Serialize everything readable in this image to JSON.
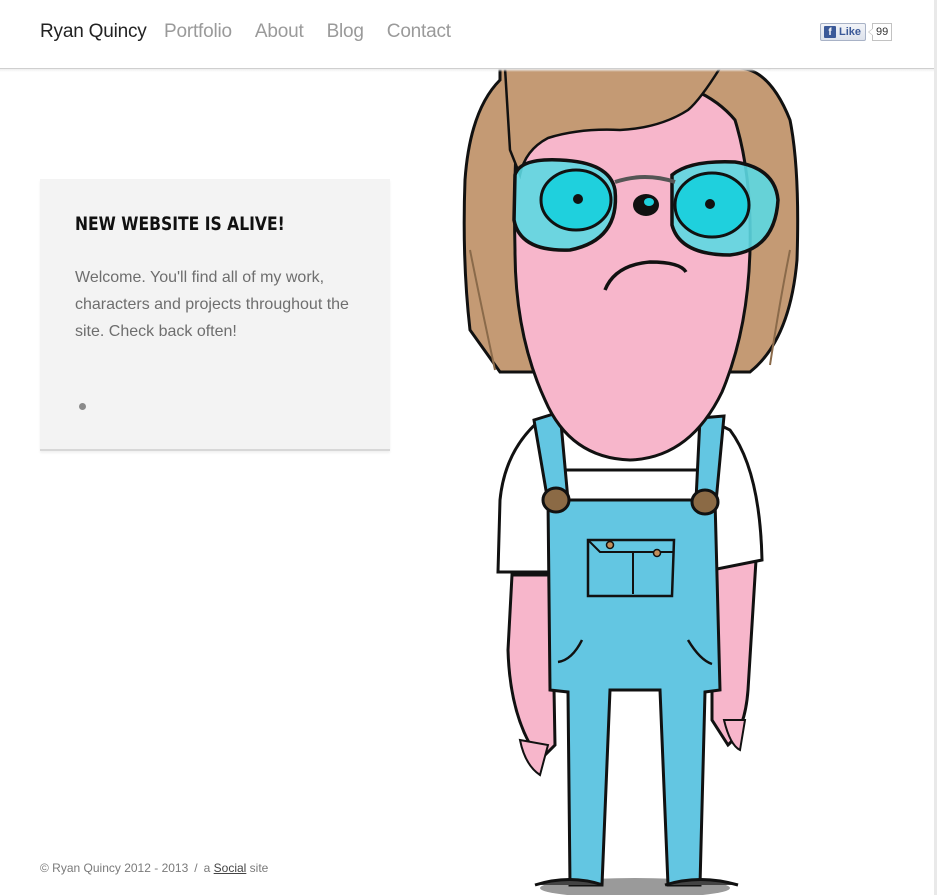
{
  "header": {
    "brand": "Ryan Quincy",
    "nav": [
      {
        "label": "Portfolio"
      },
      {
        "label": "About"
      },
      {
        "label": "Blog"
      },
      {
        "label": "Contact"
      }
    ],
    "fb_like": {
      "icon": "facebook-f-icon",
      "label": "Like",
      "count": "99"
    }
  },
  "news": {
    "title": "NEW WEBSITE IS ALIVE!",
    "body": "Welcome. You'll find all of my work, characters and projects throughout the site. Check back often!",
    "slides_total": 1,
    "active_slide": 1
  },
  "footer": {
    "copyright": "© Ryan Quincy 2012 - 2013",
    "separator": "/",
    "prefix": "a",
    "link": "Social",
    "suffix": "site"
  },
  "colors": {
    "skin": "#f7b6cb",
    "hair": "#c49a74",
    "lenses": "#5cd8e2",
    "overalls": "#63c6e2",
    "buttons": "#8b6a45",
    "nav_text": "#9a9a9a",
    "card_bg": "#f3f3f3"
  },
  "illustration": {
    "icon": "cartoon-character-illustration"
  }
}
